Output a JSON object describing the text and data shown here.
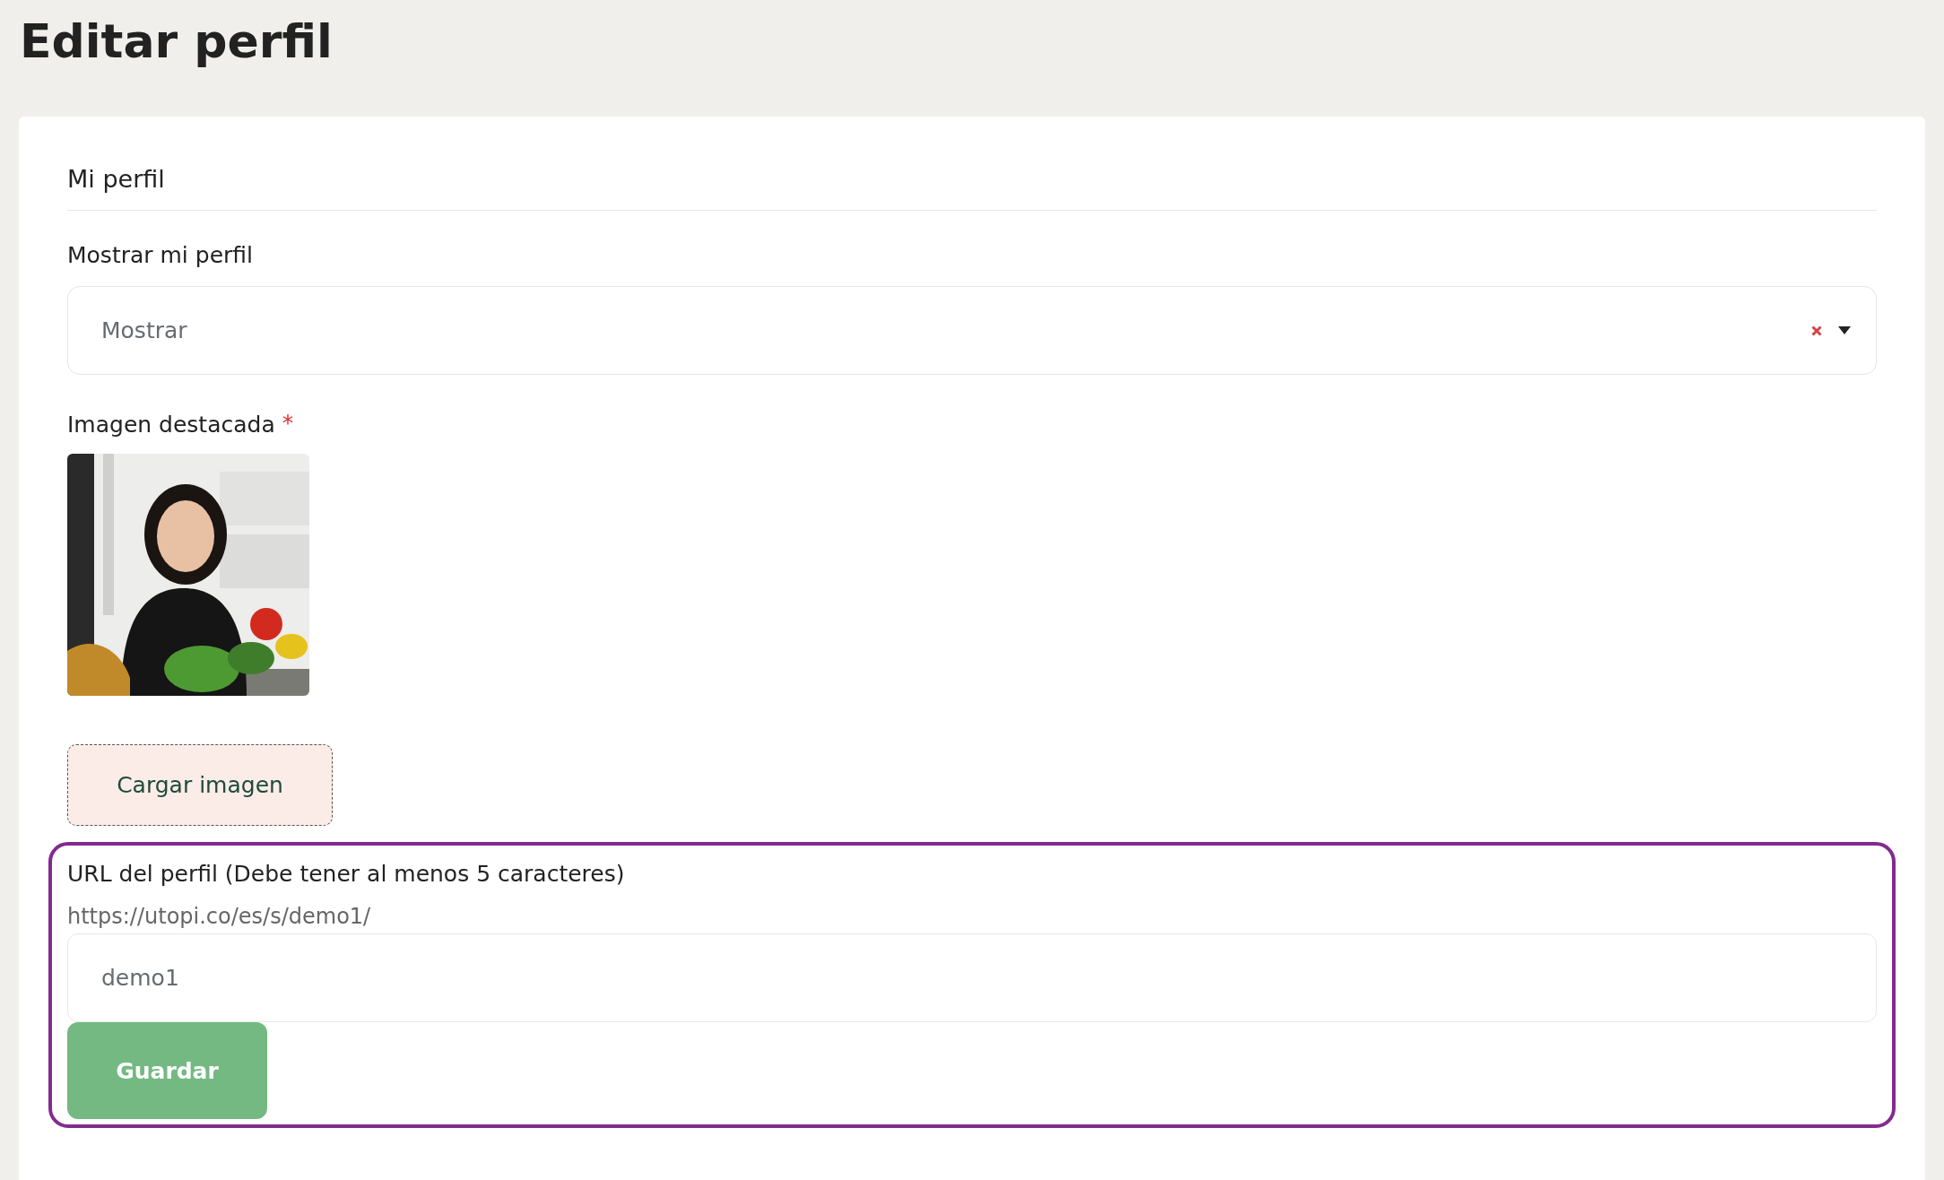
{
  "page": {
    "title": "Editar perfil"
  },
  "card": {
    "title": "Mi perfil",
    "visibility": {
      "label": "Mostrar mi perfil",
      "value": "Mostrar"
    },
    "image": {
      "label": "Imagen destacada",
      "required_mark": "*",
      "kind": "picture",
      "upload_button": "Cargar imagen"
    },
    "url": {
      "label": "URL del perfil (Debe tener al menos 5 caracteres)",
      "prefix": "https://utopi.co/es/s/demo1/",
      "value": "demo1"
    },
    "save_button": "Guardar"
  }
}
